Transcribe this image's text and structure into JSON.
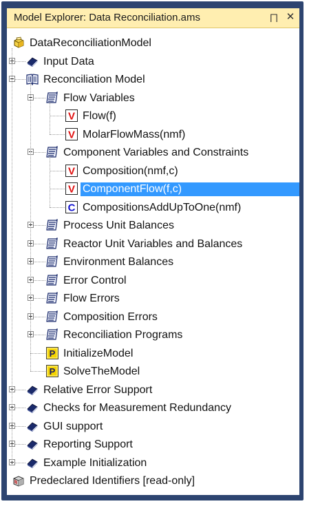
{
  "window": {
    "title": "Model Explorer: Data Reconciliation.ams",
    "pin_glyph": "⨅",
    "close_glyph": "✕"
  },
  "tree": {
    "items": [
      {
        "label": "DataReconciliationModel",
        "icon": "model-cube-icon",
        "level": 0,
        "expander": "none"
      },
      {
        "label": "Input Data",
        "icon": "book-icon",
        "level": 1,
        "expander": "plus"
      },
      {
        "label": "Reconciliation Model",
        "icon": "open-book-icon",
        "level": 1,
        "expander": "minus"
      },
      {
        "label": "Flow Variables",
        "icon": "declaration-section-icon",
        "level": 2,
        "expander": "minus"
      },
      {
        "label": "Flow(f)",
        "icon": "variable-icon",
        "level": 3,
        "expander": "none"
      },
      {
        "label": "MolarFlowMass(nmf)",
        "icon": "variable-icon",
        "level": 3,
        "expander": "none"
      },
      {
        "label": "Component Variables and Constraints",
        "icon": "declaration-section-icon",
        "level": 2,
        "expander": "minus"
      },
      {
        "label": "Composition(nmf,c)",
        "icon": "variable-icon",
        "level": 3,
        "expander": "none"
      },
      {
        "label": "ComponentFlow(f,c)",
        "icon": "variable-icon",
        "level": 3,
        "expander": "none",
        "selected": true
      },
      {
        "label": "CompositionsAddUpToOne(nmf)",
        "icon": "constraint-icon",
        "level": 3,
        "expander": "none"
      },
      {
        "label": "Process Unit Balances",
        "icon": "declaration-section-icon",
        "level": 2,
        "expander": "plus"
      },
      {
        "label": "Reactor Unit Variables and Balances",
        "icon": "declaration-section-icon",
        "level": 2,
        "expander": "plus"
      },
      {
        "label": "Environment Balances",
        "icon": "declaration-section-icon",
        "level": 2,
        "expander": "plus"
      },
      {
        "label": "Error Control",
        "icon": "declaration-section-icon",
        "level": 2,
        "expander": "plus"
      },
      {
        "label": "Flow Errors",
        "icon": "declaration-section-icon",
        "level": 2,
        "expander": "plus"
      },
      {
        "label": "Composition Errors",
        "icon": "declaration-section-icon",
        "level": 2,
        "expander": "plus"
      },
      {
        "label": "Reconciliation Programs",
        "icon": "declaration-section-icon",
        "level": 2,
        "expander": "plus"
      },
      {
        "label": "InitializeModel",
        "icon": "procedure-icon",
        "level": 2,
        "expander": "none"
      },
      {
        "label": "SolveTheModel",
        "icon": "procedure-icon",
        "level": 2,
        "expander": "none"
      },
      {
        "label": "Relative Error Support",
        "icon": "book-icon",
        "level": 1,
        "expander": "plus"
      },
      {
        "label": "Checks for Measurement Redundancy",
        "icon": "book-icon",
        "level": 1,
        "expander": "plus"
      },
      {
        "label": "GUI support",
        "icon": "book-icon",
        "level": 1,
        "expander": "plus"
      },
      {
        "label": "Reporting Support",
        "icon": "book-icon",
        "level": 1,
        "expander": "plus"
      },
      {
        "label": "Example Initialization",
        "icon": "book-icon",
        "level": 1,
        "expander": "plus"
      },
      {
        "label": "Predeclared Identifiers [read-only]",
        "icon": "predeclared-box-icon",
        "level": 0,
        "expander": "none"
      }
    ]
  },
  "colors": {
    "frame": "#2d4470",
    "titlebar": "#ffeeb0",
    "selection": "#3399ff",
    "variable_red": "#e01010",
    "constraint_blue": "#1010d0",
    "procedure_yellow": "#f5d400",
    "book_navy": "#1a2a6b"
  }
}
